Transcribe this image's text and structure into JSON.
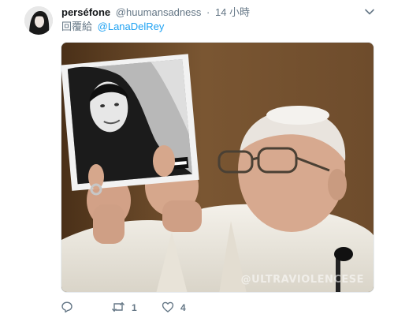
{
  "tweet": {
    "display_name": "perséfone",
    "handle": "@huumansadness",
    "separator": "·",
    "time": "14 小時",
    "reply_prefix": "回覆給",
    "reply_to": "@LanaDelRey",
    "media": {
      "watermark": "@ULTRAVIOLENCESE",
      "advisory_label": "PARENTAL ADVISORY"
    },
    "actions": {
      "reply_icon": "comment-icon",
      "retweet_icon": "retweet-icon",
      "retweet_count": "1",
      "like_icon": "heart-icon",
      "like_count": "4"
    }
  },
  "colors": {
    "text_primary": "#14171a",
    "text_secondary": "#657786",
    "link": "#1da1f2"
  }
}
